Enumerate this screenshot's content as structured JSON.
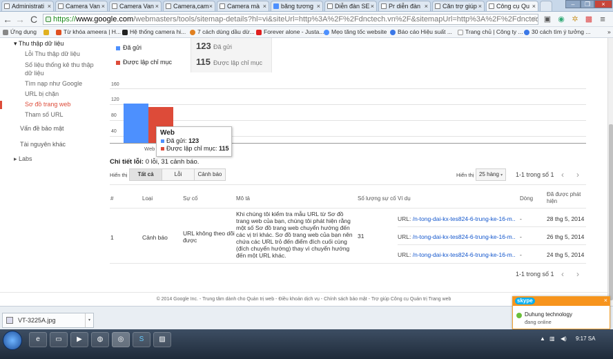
{
  "browser": {
    "tabs": [
      {
        "label": "Administrati"
      },
      {
        "label": "Camera Van"
      },
      {
        "label": "Camera Van"
      },
      {
        "label": "Camera,cam"
      },
      {
        "label": "Camera mà"
      },
      {
        "label": "băng tương"
      },
      {
        "label": "Diễn đàn SE"
      },
      {
        "label": "Pr diễn đàn"
      },
      {
        "label": "Căn trợ giúp"
      },
      {
        "label": "Công cụ Qu"
      }
    ],
    "url": {
      "scheme": "https://",
      "host": "www.google.com",
      "rest": "/webmasters/tools/sitemap-details?hl=vi&siteUrl=http%3A%2F%2Fdnctech.vn%2F&sitemapUrl=http%3A%2F%2Fdnctech.vn%"
    },
    "bookmarks": [
      "Ứng dụng",
      "Từ khóa ameera | H...",
      "Hệ thống camera hi...",
      "7 cách dùng dầu dừ...",
      "Forever alone - Justa...",
      "Mẹo tăng tốc website",
      "Báo cáo Hiệu suất ...",
      "Trang chủ | Công ty ...",
      "30 cách tìm ý tưởng ..."
    ]
  },
  "sidebar": {
    "section": "Thu thập dữ liệu",
    "items": [
      "Lỗi Thu thập dữ liệu",
      "Số liệu thống kê thu thập dữ liệu",
      "Tìm nạp như Google",
      "URL bị chặn",
      "Sơ đồ trang web",
      "Tham số URL"
    ],
    "groups": [
      "Vấn đề bảo mật",
      "Tài nguyên khác",
      "Labs"
    ]
  },
  "summary": {
    "submitted_label": "Đã gửi",
    "indexed_label": "Được lập chỉ mục",
    "submitted_value": "123",
    "indexed_value": "115",
    "submitted_color": "#4d90fe",
    "indexed_color": "#dd4b39"
  },
  "chart_data": {
    "type": "bar",
    "categories": [
      "Web"
    ],
    "series": [
      {
        "name": "Đã gửi",
        "values": [
          123
        ],
        "color": "#4d90fe"
      },
      {
        "name": "Được lập chỉ mục",
        "values": [
          115
        ],
        "color": "#dd4b39"
      }
    ],
    "y_ticks": [
      "160",
      "120",
      "80",
      "40"
    ],
    "ylim": [
      0,
      160
    ],
    "grid": true,
    "tooltip": {
      "title": "Web",
      "rows": [
        {
          "label": "Đã gửi",
          "value": "123"
        },
        {
          "label": "Được lập chỉ mục",
          "value": "115"
        }
      ]
    }
  },
  "details": {
    "label": "Chi tiết lỗi:",
    "summary": "0 lỗi, 31 cảnh báo.",
    "show_label": "Hiển thị",
    "filters": [
      "Tất cả",
      "Lỗi",
      "Cảnh báo"
    ],
    "rows_label": "Hiển thị",
    "rows_value": "25 hàng",
    "range": "1-1 trong số 1"
  },
  "table": {
    "headers": [
      "#",
      "Loại",
      "Sự cố",
      "Mô tả",
      "Số lượng sự cố",
      "Ví dụ",
      "Dòng",
      "Đã được phát hiện"
    ],
    "row": {
      "index": "1",
      "type": "Cảnh báo",
      "issue": "URL không theo dõi được",
      "description": "Khi chúng tôi kiểm tra mẫu URL từ Sơ đồ trang web của bạn, chúng tôi phát hiện rằng một số Sơ đồ trang web chuyển hướng đến các vị trí khác. Sơ đồ trang web của bạn nên chứa các URL trỏ đến điểm đích cuối cùng (đích chuyển hướng) thay vì chuyển hướng đến một URL khác.",
      "count": "31",
      "examples": [
        {
          "prefix": "URL:",
          "url": "/n-tong-dai-kx-tes824-6-trung-ke-16-m...",
          "line": "-",
          "date": "28 thg 5, 2014"
        },
        {
          "prefix": "URL:",
          "url": "/n-tong-dai-kx-tes824-6-trung-ke-16-m...",
          "line": "-",
          "date": "26 thg 5, 2014"
        },
        {
          "prefix": "URL:",
          "url": "/n-tong-dai-kx-tes824-6-trung-ke-16-m...",
          "line": "-",
          "date": "24 thg 5, 2014"
        }
      ]
    }
  },
  "footer": "© 2014 Google Inc. - Trung tâm dành cho Quản trị web - Điều khoản dịch vụ - Chính sách bảo mật - Trợ giúp Công cụ Quản trị Trang web",
  "download": {
    "filename": "VT-3225A.jpg"
  },
  "skype": {
    "logo": "skype",
    "name": "Duhung technology",
    "status": "đang online"
  },
  "taskbar": {
    "clock": "9:17 SA"
  }
}
